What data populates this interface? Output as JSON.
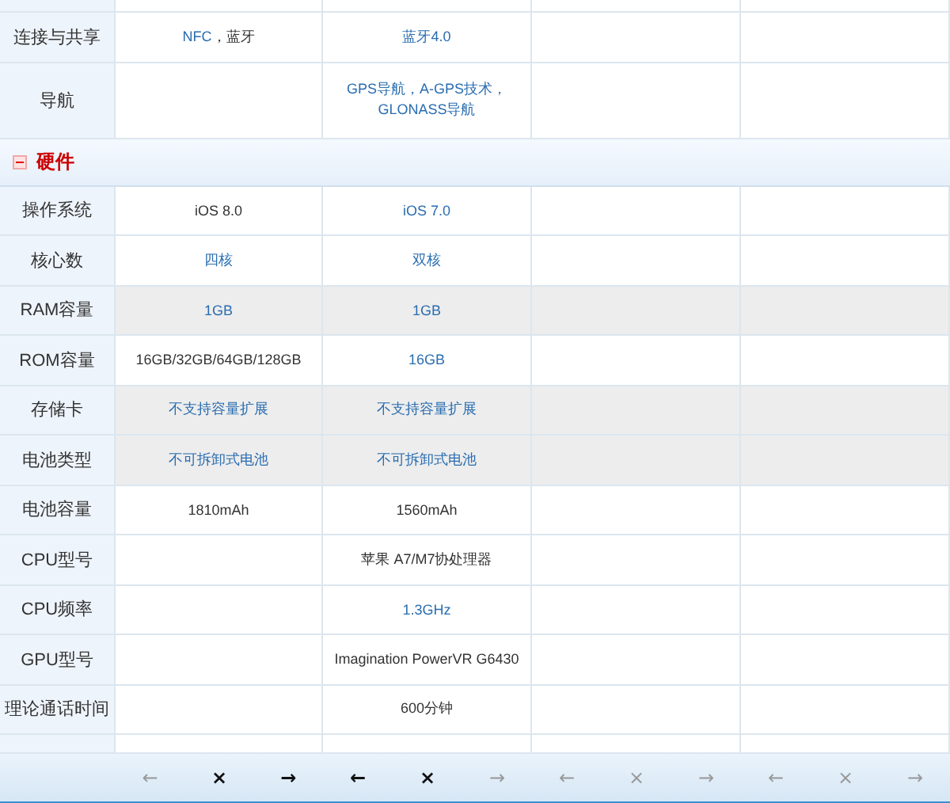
{
  "rows_before": [
    {
      "label": "连接与共享",
      "shaded": false,
      "cells": [
        {
          "text": "NFC",
          "link": true,
          "suffix": "，蓝牙"
        },
        {
          "text": "蓝牙4.0",
          "link": true
        },
        null,
        null
      ]
    },
    {
      "label": "导航",
      "shaded": false,
      "cells": [
        null,
        {
          "text": "GPS导航，A-GPS技术，GLONASS导航",
          "link": true
        },
        null,
        null
      ]
    }
  ],
  "section": {
    "title": "硬件",
    "expanded": true
  },
  "rows": [
    {
      "label": "操作系统",
      "shaded": false,
      "cells": [
        {
          "text": "iOS 8.0",
          "link": false
        },
        {
          "text": "iOS 7.0",
          "link": true
        },
        null,
        null
      ]
    },
    {
      "label": "核心数",
      "shaded": false,
      "cells": [
        {
          "text": "四核",
          "link": true
        },
        {
          "text": "双核",
          "link": true
        },
        null,
        null
      ]
    },
    {
      "label": "RAM容量",
      "shaded": true,
      "cells": [
        {
          "text": "1GB",
          "link": true
        },
        {
          "text": "1GB",
          "link": true
        },
        null,
        null
      ]
    },
    {
      "label": "ROM容量",
      "shaded": false,
      "cells": [
        {
          "text": "16GB/32GB/64GB/128GB",
          "link": false
        },
        {
          "text": "16GB",
          "link": true
        },
        null,
        null
      ]
    },
    {
      "label": "存储卡",
      "shaded": true,
      "cells": [
        {
          "text": "不支持容量扩展",
          "link": true
        },
        {
          "text": "不支持容量扩展",
          "link": true
        },
        null,
        null
      ]
    },
    {
      "label": "电池类型",
      "shaded": true,
      "cells": [
        {
          "text": "不可拆卸式电池",
          "link": true
        },
        {
          "text": "不可拆卸式电池",
          "link": true
        },
        null,
        null
      ]
    },
    {
      "label": "电池容量",
      "shaded": false,
      "cells": [
        {
          "text": "1810mAh",
          "link": false
        },
        {
          "text": "1560mAh",
          "link": false
        },
        null,
        null
      ]
    },
    {
      "label": "CPU型号",
      "shaded": false,
      "cells": [
        null,
        {
          "text": "苹果 A7/M7协处理器",
          "link": false
        },
        null,
        null
      ]
    },
    {
      "label": "CPU频率",
      "shaded": false,
      "cells": [
        null,
        {
          "text": "1.3GHz",
          "link": true
        },
        null,
        null
      ]
    },
    {
      "label": "GPU型号",
      "shaded": false,
      "cells": [
        null,
        {
          "text": "Imagination PowerVR G6430",
          "link": false
        },
        null,
        null
      ]
    },
    {
      "label": "理论通话时间",
      "shaded": false,
      "cells": [
        null,
        {
          "text": "600分钟",
          "link": false
        },
        null,
        null
      ]
    }
  ],
  "footer": [
    {
      "prev": {
        "label": "←",
        "disabled": true
      },
      "close": {
        "label": "×",
        "disabled": false
      },
      "next": {
        "label": "→",
        "disabled": false
      }
    },
    {
      "prev": {
        "label": "←",
        "disabled": false
      },
      "close": {
        "label": "×",
        "disabled": false
      },
      "next": {
        "label": "→",
        "disabled": true
      }
    },
    {
      "prev": {
        "label": "←",
        "disabled": true
      },
      "close": {
        "label": "×",
        "disabled": true
      },
      "next": {
        "label": "→",
        "disabled": true
      }
    },
    {
      "prev": {
        "label": "←",
        "disabled": true
      },
      "close": {
        "label": "×",
        "disabled": true
      },
      "next": {
        "label": "→",
        "disabled": true
      }
    }
  ]
}
